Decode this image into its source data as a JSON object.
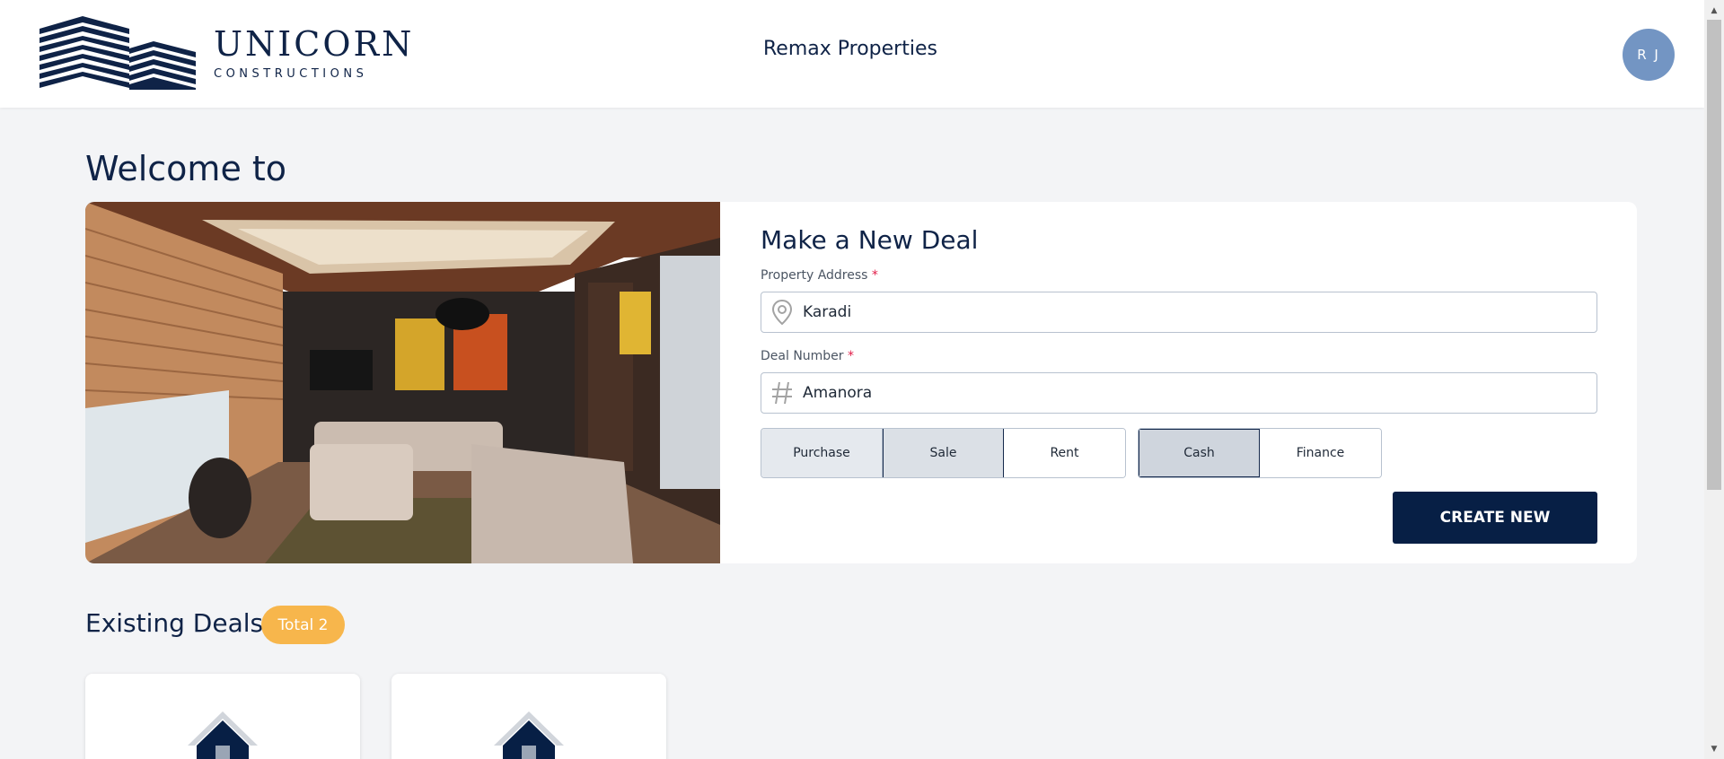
{
  "header": {
    "logo_title": "UNICORN",
    "logo_subtitle": "CONSTRUCTIONS",
    "company_name": "Remax Properties",
    "avatar_initials": "R J"
  },
  "page": {
    "welcome": "Welcome to"
  },
  "new_deal": {
    "title": "Make a New Deal",
    "address_label": "Property Address",
    "address_value": "Karadi",
    "address_icon": "location-pin-icon",
    "deal_label": "Deal Number",
    "deal_value": "Amanora",
    "deal_icon": "hash-icon",
    "required_mark": "*",
    "deal_types": [
      "Purchase",
      "Sale",
      "Rent"
    ],
    "selected_deal_type": "Sale",
    "payment_types": [
      "Cash",
      "Finance"
    ],
    "selected_payment_type": "Cash",
    "create_label": "CREATE NEW"
  },
  "existing": {
    "title": "Existing Deals",
    "badge": "Total 2",
    "card_icon": "house-icon"
  },
  "colors": {
    "primary": "#071f45",
    "badge": "#f7b64c",
    "avatar": "#7395c3",
    "background": "#f3f4f6"
  }
}
